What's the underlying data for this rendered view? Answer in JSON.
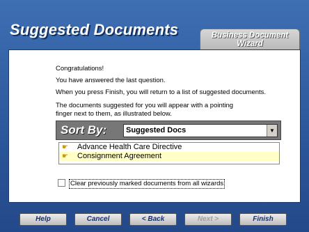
{
  "window": {
    "title": "Suggested Documents",
    "tab_line1": "Business Document",
    "tab_line2": "Wizard"
  },
  "content": {
    "lines": [
      "Congratulations!",
      "You have answered the last question.",
      "When you press Finish, you will return to a list of suggested documents.",
      "The documents suggested for you will appear with a pointing",
      "finger next to them, as illustrated below."
    ]
  },
  "sort": {
    "label": "Sort By:",
    "selected": "Suggested Docs",
    "dropdown_icon": "chevron-down-icon"
  },
  "documents": [
    {
      "name": "Advance Health Care Directive",
      "highlighted": false,
      "icon": "pointing-finger-icon"
    },
    {
      "name": "Consignment Agreement",
      "highlighted": true,
      "icon": "pointing-finger-icon"
    }
  ],
  "options": {
    "clear_label": "Clear previously marked documents from all wizards",
    "clear_checked": false
  },
  "buttons": {
    "help": "Help",
    "cancel": "Cancel",
    "back": "< Back",
    "next": "Next >",
    "finish": "Finish"
  },
  "colors": {
    "window_bg": "#2b569a",
    "highlight_row": "#ffffc6",
    "button_text": "#1a2f6a"
  }
}
